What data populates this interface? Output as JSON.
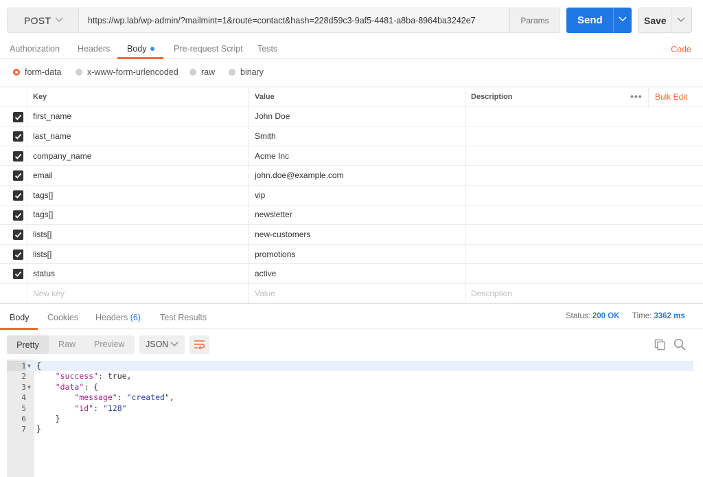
{
  "request": {
    "method": "POST",
    "url": "https://wp.lab/wp-admin/?mailmint=1&route=contact&hash=228d59c3-9af5-4481-a8ba-8964ba3242e7",
    "params_label": "Params",
    "send_label": "Send",
    "save_label": "Save"
  },
  "request_tabs": [
    {
      "label": "Authorization"
    },
    {
      "label": "Headers"
    },
    {
      "label": "Body"
    },
    {
      "label": "Pre-request Script"
    },
    {
      "label": "Tests"
    }
  ],
  "code_link": "Code",
  "body_modes": [
    {
      "label": "form-data",
      "selected": true
    },
    {
      "label": "x-www-form-urlencoded",
      "selected": false
    },
    {
      "label": "raw",
      "selected": false
    },
    {
      "label": "binary",
      "selected": false
    }
  ],
  "params_table": {
    "headers": {
      "key": "Key",
      "value": "Value",
      "description": "Description"
    },
    "bulk_edit": "Bulk Edit",
    "rows": [
      {
        "key": "first_name",
        "value": "John Doe",
        "checked": true
      },
      {
        "key": "last_name",
        "value": "Smith",
        "checked": true
      },
      {
        "key": "company_name",
        "value": "Acme Inc",
        "checked": true
      },
      {
        "key": "email",
        "value": "john.doe@example.com",
        "checked": true
      },
      {
        "key": "tags[]",
        "value": "vip",
        "checked": true
      },
      {
        "key": "tags[]",
        "value": "newsletter",
        "checked": true
      },
      {
        "key": "lists[]",
        "value": "new-customers",
        "checked": true
      },
      {
        "key": "lists[]",
        "value": "promotions",
        "checked": true
      },
      {
        "key": "status",
        "value": "active",
        "checked": true
      }
    ],
    "placeholders": {
      "key": "New key",
      "value": "Value",
      "description": "Description"
    }
  },
  "response": {
    "tabs": [
      {
        "label": "Body"
      },
      {
        "label": "Cookies"
      },
      {
        "label": "Headers",
        "count": "(6)"
      },
      {
        "label": "Test Results"
      }
    ],
    "status_label": "Status:",
    "status_value": "200 OK",
    "time_label": "Time:",
    "time_value": "3362 ms",
    "view_modes": [
      {
        "label": "Pretty"
      },
      {
        "label": "Raw"
      },
      {
        "label": "Preview"
      }
    ],
    "format": "JSON",
    "code_lines": [
      {
        "num": "1",
        "fold": true
      },
      {
        "num": "2"
      },
      {
        "num": "3",
        "fold": true
      },
      {
        "num": "4"
      },
      {
        "num": "5"
      },
      {
        "num": "6"
      },
      {
        "num": "7"
      }
    ],
    "json": {
      "success_key": "\"success\"",
      "success_val": "true",
      "data_key": "\"data\"",
      "message_key": "\"message\"",
      "message_val": "\"created\"",
      "id_key": "\"id\"",
      "id_val": "\"128\""
    }
  },
  "colors": {
    "accent": "#f26b3a",
    "send": "#1f76e5",
    "link": "#2a7ee0"
  },
  "icons": [
    "chevron-down-icon",
    "wrap-icon",
    "copy-icon",
    "search-icon",
    "more-icon",
    "checkbox-checked-icon",
    "fold-arrow-icon"
  ]
}
